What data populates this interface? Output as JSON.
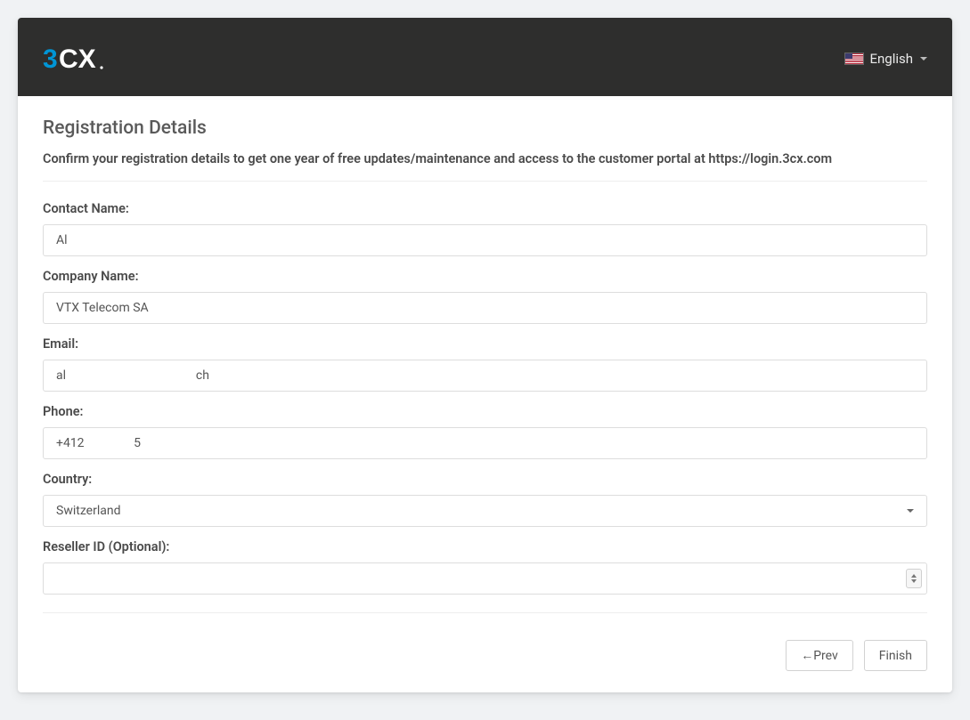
{
  "header": {
    "language_label": "English"
  },
  "page": {
    "title": "Registration Details",
    "subtitle": "Confirm your registration details to get one year of free updates/maintenance and access to the customer portal at https://login.3cx.com"
  },
  "form": {
    "contact_name": {
      "label": "Contact Name:",
      "value": "Al"
    },
    "company_name": {
      "label": "Company Name:",
      "value": "VTX Telecom SA"
    },
    "email": {
      "label": "Email:",
      "value": "al                                          ch"
    },
    "phone": {
      "label": "Phone:",
      "value": "+412                5"
    },
    "country": {
      "label": "Country:",
      "value": "Switzerland"
    },
    "reseller_id": {
      "label": "Reseller ID (Optional):",
      "value": ""
    }
  },
  "footer": {
    "prev_label": "←Prev",
    "finish_label": "Finish"
  }
}
